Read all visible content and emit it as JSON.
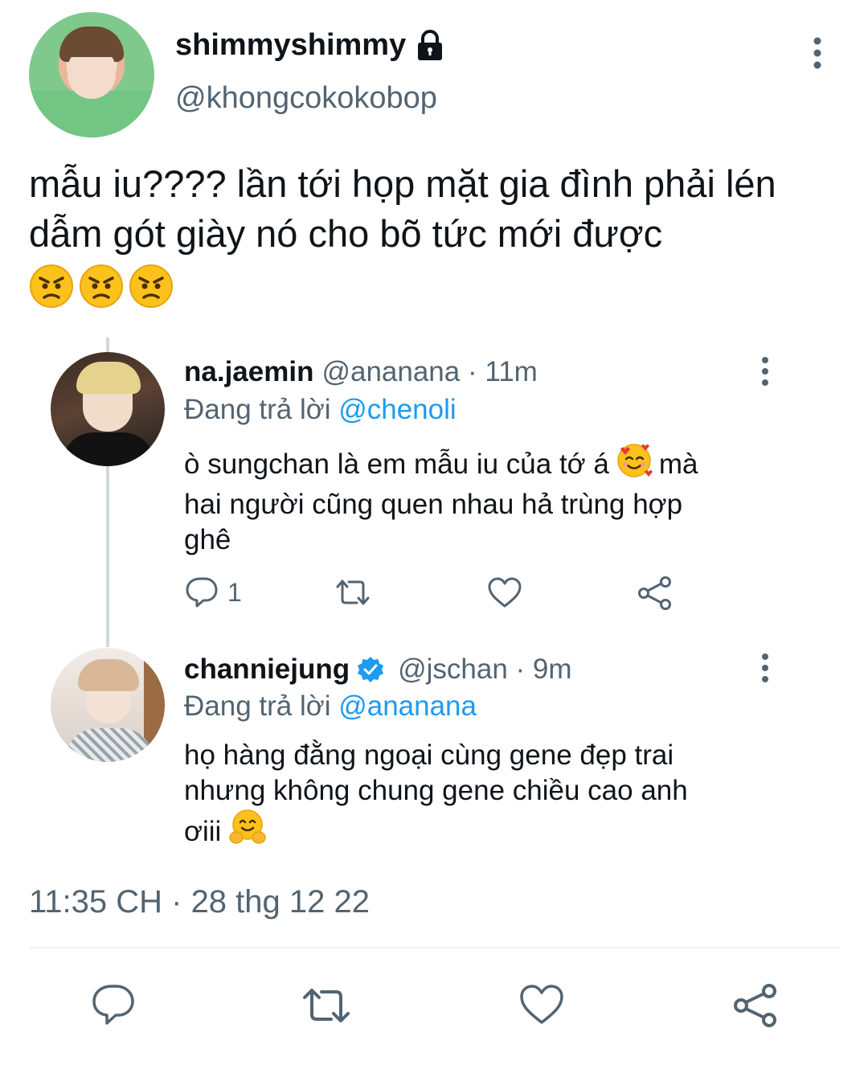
{
  "tweet": {
    "author_name": "shimmyshimmy",
    "author_handle": "@khongcokokobop",
    "lock_icon": "lock-icon",
    "text": "mẫu iu???? lần tới họp mặt gia đình phải lén dẫm gót giày nó cho bõ tức mới được",
    "emojis": [
      "angry-face-icon",
      "angry-face-icon",
      "angry-face-icon"
    ],
    "timestamp": "11:35 CH · 28 thg 12 22"
  },
  "replies": [
    {
      "name": "na.jaemin",
      "meta": "@ananana · 11m",
      "replying_prefix": "Đang trả lời",
      "replying_to": "@chenoli",
      "text_line1": "ò sungchan là em mẫu iu của tớ á",
      "text_line1_after": "mà",
      "text_rest_l2": "hai người cũng quen nhau hả trùng hợp",
      "text_rest_l3": "ghê",
      "emoji": "smiling-face-with-hearts-icon",
      "reply_count": "1"
    },
    {
      "name": "channiejung",
      "verified_icon": "verified-badge-icon",
      "meta": "@jschan · 9m",
      "replying_prefix": "Đang trả lời",
      "replying_to": "@ananana",
      "text_l1": "họ hàng đằng ngoại cùng gene đẹp trai",
      "text_l2": "nhưng không chung gene chiều cao anh",
      "text_l3": "ơiii",
      "emoji": "hugging-face-icon"
    }
  ],
  "colors": {
    "text": "#0f1419",
    "secondary": "#536471",
    "link": "#1d9bf0",
    "divider": "#eff3f4"
  }
}
